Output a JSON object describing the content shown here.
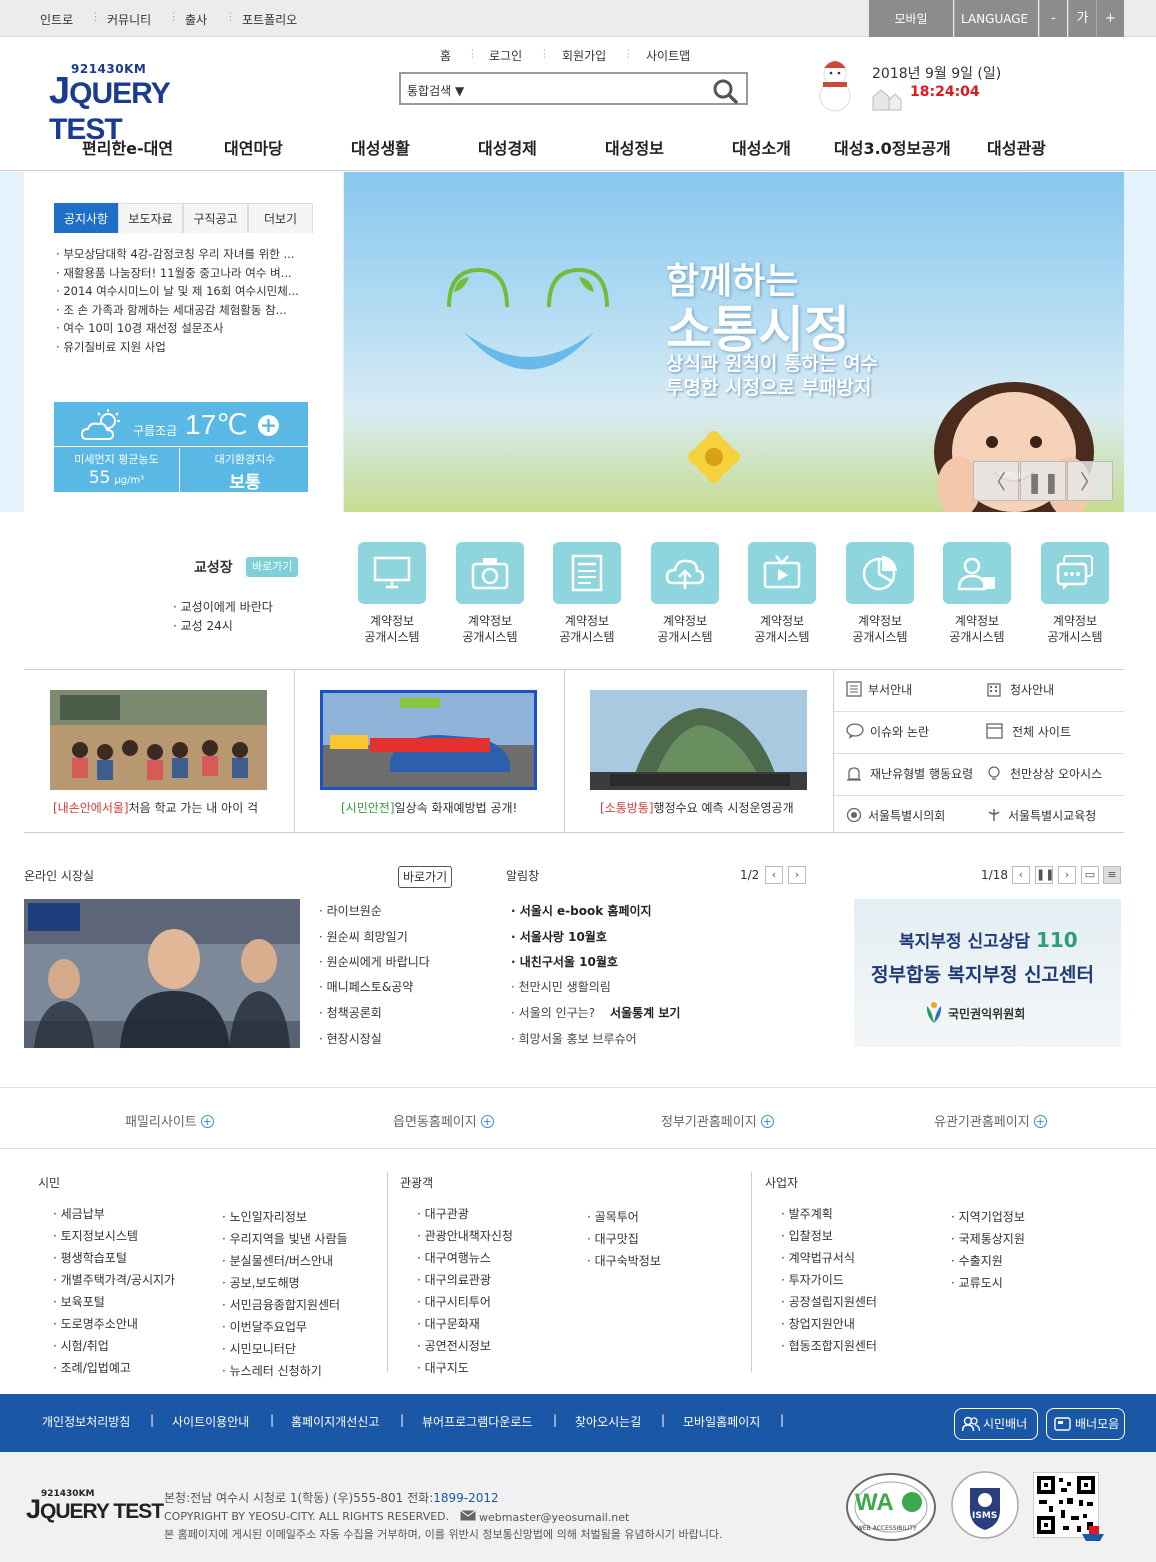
{
  "topbar": {
    "links": [
      "인트로",
      "커뮤니티",
      "출사",
      "포트폴리오"
    ],
    "mobile": "모바일",
    "language": "LANGUAGE ▼",
    "font_minus": "-",
    "font_label": "가",
    "font_plus": "+"
  },
  "header": {
    "logo_small": "921430KM",
    "logo_big": "QUERY TEST",
    "logo_j": "J",
    "links": [
      "홈",
      "로그인",
      "회원가입",
      "사이트맵"
    ],
    "search_select": "통합검색 ▼",
    "search_placeholder": "",
    "date": "2018년 9월 9일 (일)",
    "clock": "18:24:04"
  },
  "gnb": [
    "편리한e-대연",
    "대연마당",
    "대성생활",
    "대성경제",
    "대성정보",
    "대성소개",
    "대성3.0정보공개",
    "대성관광"
  ],
  "notice": {
    "tabs": [
      "공지사항",
      "보도자료",
      "구직공고",
      "더보기"
    ],
    "items": [
      "부모상담대학 4강-감정코칭 우리 자녀를 위한 ...",
      "재활용품 나눔장터! 11월중 중고나라 여수 벼...",
      "2014 여수시미느이 날 및 제 16회 여수시민체...",
      "조 손 가족과 함께하는 세대공감 체험활동 참...",
      "여수 10미 10경 재선정 설문조사",
      "유기질비료 지원 사업"
    ]
  },
  "weather": {
    "condition": "구름조금",
    "temp": "17℃",
    "dust_label": "미세먼지 평균농도",
    "dust_value": "55",
    "dust_unit": "μg/m³",
    "air_label": "대기환경지수",
    "air_value": "보통"
  },
  "banner": {
    "title1": "함께하는",
    "title2": "소통시정",
    "sub1": "상식과 원칙이 통하는 여수",
    "sub2": "투명한 시정으로 부패방지",
    "prev": "〈",
    "pause": "❚❚",
    "next": "〉"
  },
  "gyoseong": {
    "title": "교성장",
    "button": "바로가기",
    "links": [
      "교성이에게 바란다",
      "교성 24시"
    ]
  },
  "quick_icons": [
    {
      "icon": "monitor-icon",
      "line1": "계약정보",
      "line2": "공개시스템"
    },
    {
      "icon": "camera-icon",
      "line1": "계약정보",
      "line2": "공개시스템"
    },
    {
      "icon": "newspaper-icon",
      "line1": "계약정보",
      "line2": "공개시스템"
    },
    {
      "icon": "cloud-upload-icon",
      "line1": "계약정보",
      "line2": "공개시스템"
    },
    {
      "icon": "tv-icon",
      "line1": "계약정보",
      "line2": "공개시스템"
    },
    {
      "icon": "pie-chart-icon",
      "line1": "계약정보",
      "line2": "공개시스템"
    },
    {
      "icon": "users-icon",
      "line1": "계약정보",
      "line2": "공개시스템"
    },
    {
      "icon": "chat-icon",
      "line1": "계약정보",
      "line2": "공개시스템"
    }
  ],
  "videos": [
    {
      "tag": "[내손안에서울]",
      "text": "처음 학교 가는 내 아이 걱"
    },
    {
      "tag": "[시민안전]",
      "text": "일상속 화재예방법 공개!"
    },
    {
      "tag": "[소통방통]",
      "text": "행정수요 예측 시정운영공개"
    }
  ],
  "quick_links": [
    "부서안내",
    "청사안내",
    "이슈와 논란",
    "전체 사이트",
    "재난유형별 행동요령",
    "천만상상 오아시스",
    "서울특별시의회",
    "서울특별시교육청"
  ],
  "online": {
    "title": "온라인 시장실",
    "button": "바로가기",
    "items": [
      "라이브원순",
      "원순씨 희망일기",
      "원순씨에게 바랍니다",
      "매니페스토&공약",
      "청책공론회",
      "현장시장실"
    ]
  },
  "alarm": {
    "title": "알림창",
    "page": "1/2",
    "items": [
      "서울시 e-book 홈페이지",
      "서울사랑 10월호",
      "내친구서울 10월호",
      "천만시민 생활의림",
      "서울의 인구는?",
      "희망서울 홍보 브루슈어"
    ],
    "item5_extra": "서울통계 보기"
  },
  "welfare": {
    "page": "1/18",
    "line1": "복지부정 신고상담",
    "num": "110",
    "line2": "정부합동 복지부정 신고센터",
    "org": "국민권익위원회"
  },
  "family": [
    "패밀리사이트",
    "읍면동홈페이지",
    "정부기관홈페이지",
    "유관기관홈페이지"
  ],
  "sitemap": {
    "citizen": {
      "title": "시민",
      "col1": [
        "세금납부",
        "토지정보시스템",
        "평생학습포털",
        "개별주택가격/공시지가",
        "보육포털",
        "도로명주소안내",
        "시험/취업",
        "조례/입법예고"
      ],
      "col2": [
        "노인일자리정보",
        "우리지역을 빛낸 사람들",
        "분실물센터/버스안내",
        "공보,보도해명",
        "서민금융종합지원센터",
        "이번달주요업무",
        "시민모니터단",
        "뉴스레터 신청하기"
      ]
    },
    "tourist": {
      "title": "관광객",
      "col1": [
        "대구관광",
        "관광안내책자신청",
        "대구여행뉴스",
        "대구의료관광",
        "대구시티투어",
        "대구문화재",
        "공연전시정보",
        "대구지도"
      ],
      "col2": [
        "골목투어",
        "대구맛집",
        "대구숙박정보"
      ]
    },
    "business": {
      "title": "사업자",
      "col1": [
        "발주계획",
        "입찰정보",
        "계약법규서식",
        "투자가이드",
        "공장설립지원센터",
        "창업지원안내",
        "협동조합지원센터"
      ],
      "col2": [
        "지역기업정보",
        "국제통상지원",
        "수출지원",
        "교류도시"
      ]
    }
  },
  "footer": {
    "nav": [
      "개인정보처리방침",
      "사이트이용안내",
      "홈페이지개선신고",
      "뷰어프로그램다운로드",
      "찾아오시는길",
      "모바일홈페이지"
    ],
    "btn1": "시민배너",
    "btn2": "배너모음",
    "addr_prefix": "본청:전남 여수시 시청로 1(학동) (우)555-801 전화:",
    "phone": "1899-2012",
    "copyright": "COPYRIGHT BY YEOSU-CITY. ALL RIGHTS RESERVED.",
    "email": "webmaster@yeosumail.net",
    "notice": "본 홈페이지에 게시된 이메일주소 자동 수집을 거부하며, 이를 위반시 정보통신망법에 의해 처벌됨을 유념하시기 바랍니다.",
    "wa_label": "WA",
    "wa_text": "WEB ACCESSIBILITY",
    "isms_label": "ISMS"
  },
  "colors": {
    "brand_blue": "#1b57a7",
    "accent_red": "#e4151f",
    "weather_blue": "#5ab8e4",
    "icon_teal": "#8fd5de"
  }
}
